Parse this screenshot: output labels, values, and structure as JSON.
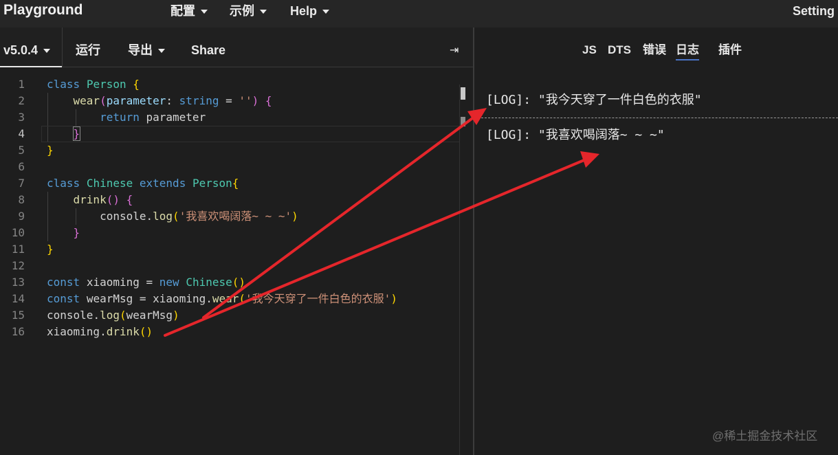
{
  "topbar": {
    "brand": "Playground",
    "menus": [
      {
        "label": "配置"
      },
      {
        "label": "示例"
      },
      {
        "label": "Help"
      }
    ],
    "settings": "Setting"
  },
  "toolbar": {
    "version": "v5.0.4",
    "run": "运行",
    "export": "导出",
    "share": "Share",
    "collapse_icon": "collapse-right-icon"
  },
  "editor": {
    "lines": [
      {
        "n": "1"
      },
      {
        "n": "2"
      },
      {
        "n": "3"
      },
      {
        "n": "4"
      },
      {
        "n": "5"
      },
      {
        "n": "6"
      },
      {
        "n": "7"
      },
      {
        "n": "8"
      },
      {
        "n": "9"
      },
      {
        "n": "10"
      },
      {
        "n": "11"
      },
      {
        "n": "12"
      },
      {
        "n": "13"
      },
      {
        "n": "14"
      },
      {
        "n": "15"
      },
      {
        "n": "16"
      }
    ],
    "tokens": {
      "l1": [
        "class",
        "Person",
        "{"
      ],
      "l2": [
        "wear",
        "(",
        "parameter",
        ": ",
        "string",
        " = ",
        "''",
        ")",
        "{"
      ],
      "l3": [
        "return",
        "parameter"
      ],
      "l4": [
        "}"
      ],
      "l5": [
        "}"
      ],
      "l7": [
        "class",
        "Chinese",
        "extends",
        "Person",
        "{"
      ],
      "l8": [
        "drink",
        "()",
        "{"
      ],
      "l9": [
        "console",
        ".",
        "log",
        "(",
        "'我喜欢喝阔落~ ~ ~'",
        ")"
      ],
      "l10": [
        "}"
      ],
      "l11": [
        "}"
      ],
      "l13": [
        "const",
        "xiaoming",
        " = ",
        "new",
        "Chinese",
        "()"
      ],
      "l14": [
        "const",
        "wearMsg",
        " = ",
        "xiaoming",
        ".",
        "wear",
        "(",
        "'我今天穿了一件白色的衣服'",
        ")"
      ],
      "l15": [
        "console",
        ".",
        "log",
        "(",
        "wearMsg",
        ")"
      ],
      "l16": [
        "xiaoming",
        ".",
        "drink",
        "()"
      ]
    }
  },
  "output": {
    "tabs": [
      {
        "label": "JS"
      },
      {
        "label": "DTS"
      },
      {
        "label": "错误"
      },
      {
        "label": "日志",
        "active": true
      },
      {
        "label": "插件"
      }
    ],
    "logs": [
      {
        "tag": "[LOG]",
        "sep": ": ",
        "text": "\"我今天穿了一件白色的衣服\""
      },
      {
        "tag": "[LOG]",
        "sep": ": ",
        "text": "\"我喜欢喝阔落~ ~ ~\""
      }
    ]
  },
  "annotations": {
    "arrow_color": "#e5262b"
  },
  "watermark": "@稀土掘金技术社区"
}
